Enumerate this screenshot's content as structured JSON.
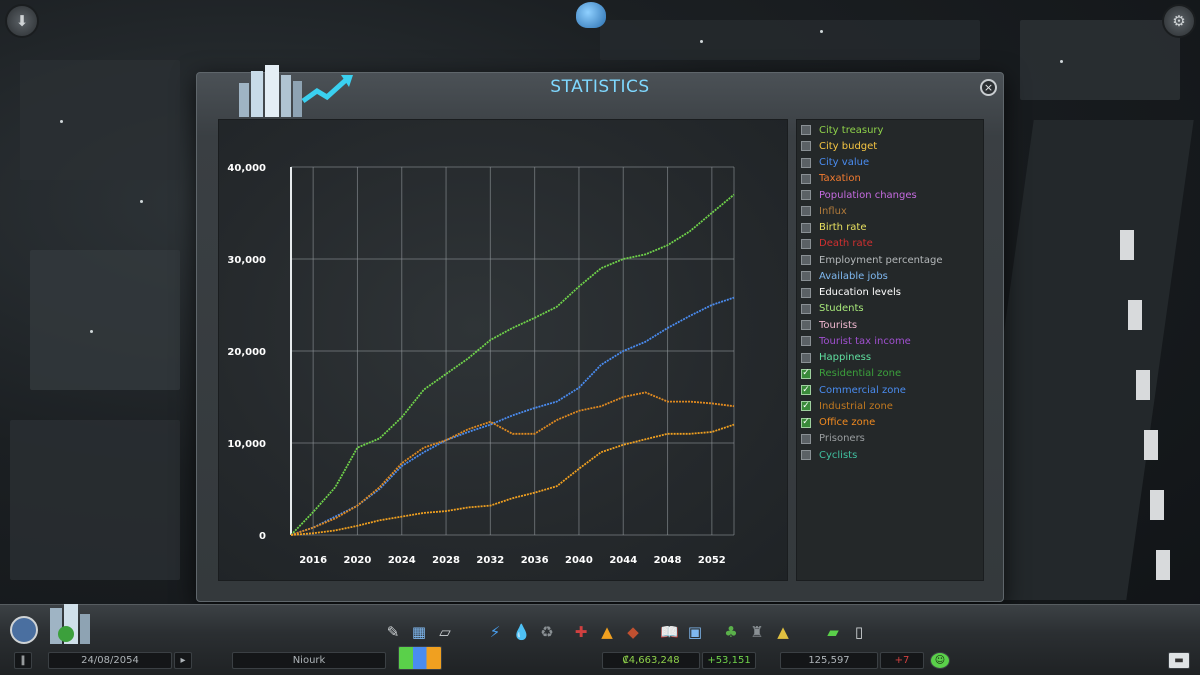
{
  "panel": {
    "title": "STATISTICS",
    "close_label": "×"
  },
  "legend": [
    {
      "label": "City treasury",
      "color": "#8ed14a",
      "checked": false
    },
    {
      "label": "City budget",
      "color": "#f5c542",
      "checked": false
    },
    {
      "label": "City value",
      "color": "#4a8cf0",
      "checked": false
    },
    {
      "label": "Taxation",
      "color": "#f07a30",
      "checked": false
    },
    {
      "label": "Population changes",
      "color": "#c56be0",
      "checked": false
    },
    {
      "label": "Influx",
      "color": "#b07a3a",
      "checked": false
    },
    {
      "label": "Birth rate",
      "color": "#e8e060",
      "checked": false
    },
    {
      "label": "Death rate",
      "color": "#d03030",
      "checked": false
    },
    {
      "label": "Employment percentage",
      "color": "#b4b8ba",
      "checked": false
    },
    {
      "label": "Available jobs",
      "color": "#7fb8f0",
      "checked": false
    },
    {
      "label": "Education levels",
      "color": "#ffffff",
      "checked": false
    },
    {
      "label": "Students",
      "color": "#a8e87a",
      "checked": false
    },
    {
      "label": "Tourists",
      "color": "#f0b8d0",
      "checked": false
    },
    {
      "label": "Tourist tax income",
      "color": "#a050d0",
      "checked": false
    },
    {
      "label": "Happiness",
      "color": "#60e0a0",
      "checked": false
    },
    {
      "label": "Residential zone",
      "color": "#3ca03c",
      "checked": true
    },
    {
      "label": "Commercial zone",
      "color": "#4a8cf0",
      "checked": true
    },
    {
      "label": "Industrial zone",
      "color": "#c07820",
      "checked": true
    },
    {
      "label": "Office zone",
      "color": "#f08a20",
      "checked": true
    },
    {
      "label": "Prisoners",
      "color": "#9a9ea0",
      "checked": false
    },
    {
      "label": "Cyclists",
      "color": "#40c0a0",
      "checked": false
    }
  ],
  "chart_data": {
    "type": "line",
    "x": [
      2014,
      2016,
      2018,
      2020,
      2022,
      2024,
      2026,
      2028,
      2030,
      2032,
      2034,
      2036,
      2038,
      2040,
      2042,
      2044,
      2046,
      2048,
      2050,
      2052,
      2054
    ],
    "x_ticks": [
      "2016",
      "2020",
      "2024",
      "2028",
      "2032",
      "2036",
      "2040",
      "2044",
      "2048",
      "2052"
    ],
    "y_ticks": [
      "0",
      "10,000",
      "20,000",
      "30,000",
      "40,000"
    ],
    "ylim": [
      0,
      40000
    ],
    "xlim": [
      2014,
      2054
    ],
    "grid": true,
    "series": [
      {
        "name": "Residential zone",
        "color": "#6fd24a",
        "values": [
          0,
          2500,
          5200,
          9500,
          10500,
          12800,
          15800,
          17500,
          19200,
          21200,
          22500,
          23600,
          24800,
          27000,
          29000,
          30000,
          30500,
          31500,
          33000,
          35000,
          37000
        ]
      },
      {
        "name": "Commercial zone",
        "color": "#4a8cf0",
        "values": [
          0,
          800,
          2000,
          3200,
          5000,
          7500,
          9000,
          10300,
          11200,
          12000,
          13000,
          13800,
          14500,
          16000,
          18500,
          20000,
          21000,
          22500,
          23800,
          25000,
          25800
        ]
      },
      {
        "name": "Industrial zone",
        "color": "#e08a20",
        "values": [
          0,
          800,
          1800,
          3200,
          5200,
          7800,
          9500,
          10300,
          11500,
          12300,
          11000,
          11000,
          12500,
          13500,
          14000,
          15000,
          15500,
          14500,
          14500,
          14300,
          14000
        ]
      },
      {
        "name": "Office zone",
        "color": "#f0a020",
        "values": [
          0,
          200,
          500,
          1000,
          1600,
          2000,
          2400,
          2600,
          3000,
          3200,
          4000,
          4600,
          5300,
          7200,
          9000,
          9800,
          10400,
          11000,
          11000,
          11200,
          12000
        ]
      }
    ]
  },
  "statusbar": {
    "date": "24/08/2054",
    "city_name": "Niourk",
    "money": "₡4,663,248",
    "income": "+53,151",
    "population": "125,597",
    "pop_change": "+7"
  }
}
